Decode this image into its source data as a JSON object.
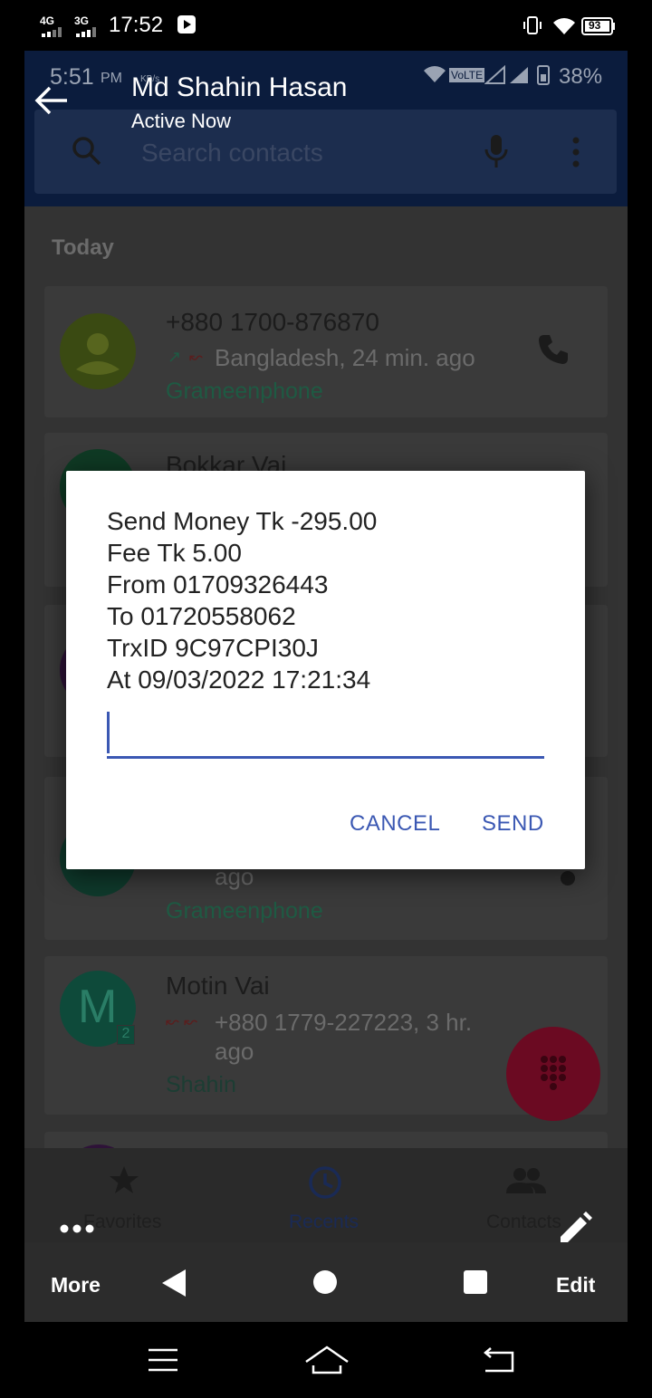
{
  "status_bar": {
    "net1": "4G",
    "net2": "3G",
    "time": "17:52",
    "battery": "93"
  },
  "inner_status": {
    "time": "5:51",
    "ampm": "PM",
    "kbs": "KB/s",
    "volte": "VoLTE",
    "battery": "38%"
  },
  "chat_header": {
    "title": "Md Shahin Hasan",
    "subtitle": "Active Now"
  },
  "background_app": {
    "search_placeholder": "Search contacts",
    "section_today": "Today",
    "items": [
      {
        "name": "+880 1700-876870",
        "detail": "Bangladesh, 24 min. ago",
        "carrier": "Grameenphone"
      },
      {
        "name": "Bokkar Vai"
      },
      {
        "detail_tail": "ago",
        "carrier": "Grameenphone"
      },
      {
        "avatar": "M",
        "badge": "2",
        "name": "Motin Vai",
        "detail": "+880 1779-227223, 3 hr.",
        "detail_tail": "ago",
        "carrier": "Shahin"
      }
    ],
    "tabs": [
      "Favorites",
      "Recents",
      "Contacts"
    ]
  },
  "dialog": {
    "lines": [
      "Send Money Tk -295.00",
      "Fee Tk 5.00",
      "From 01709326443",
      "To 01720558062",
      "TrxID 9C97CPI30J",
      "At 09/03/2022 17:21:34"
    ],
    "input_value": "",
    "cancel": "CANCEL",
    "send": "SEND"
  },
  "action_bar": {
    "more": "More",
    "edit": "Edit"
  },
  "colors": {
    "accent": "#3b58b3",
    "inner_header": "#0b1c3d",
    "fab": "#6b0a22"
  }
}
